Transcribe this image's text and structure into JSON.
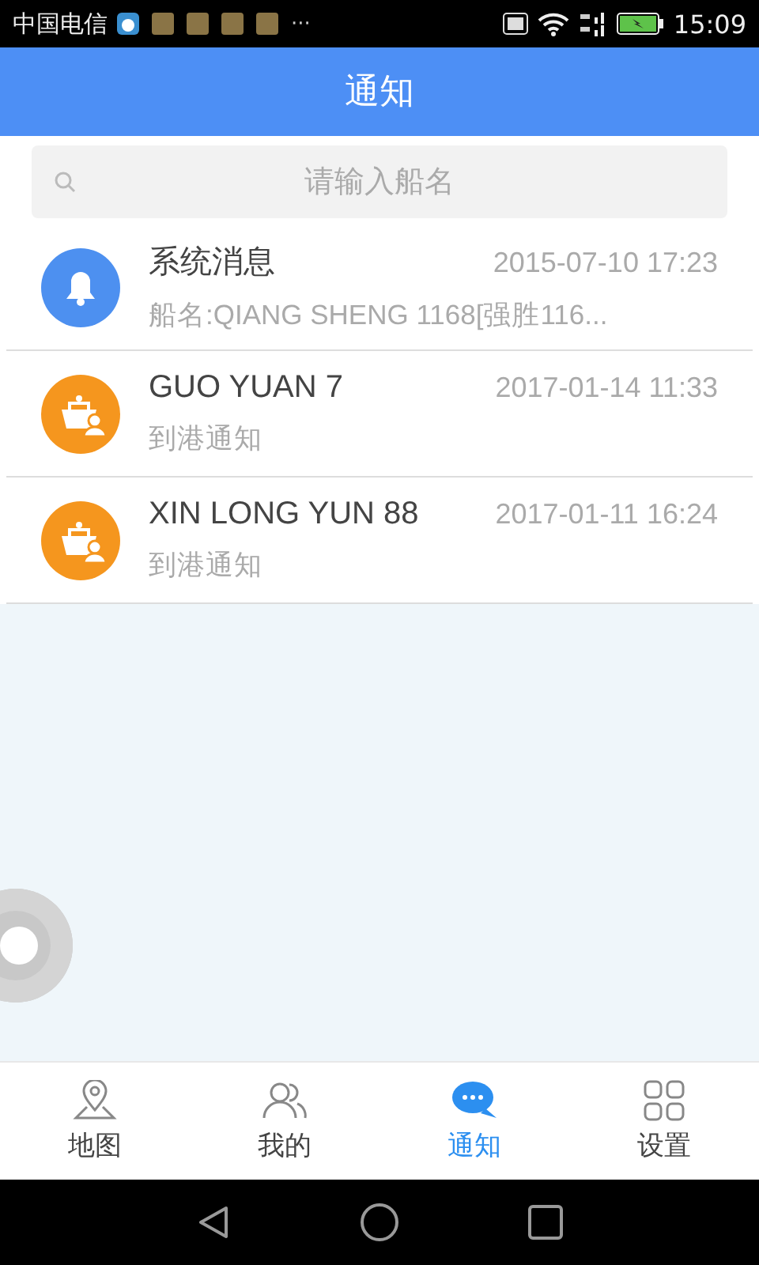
{
  "status_bar": {
    "carrier": "中国电信",
    "more": "···",
    "time": "15:09"
  },
  "header": {
    "title": "通知"
  },
  "search": {
    "placeholder": "请输入船名"
  },
  "messages": [
    {
      "kind": "system",
      "title": "系统消息",
      "time": "2015-07-10 17:23",
      "subtitle": "船名:QIANG SHENG 1168[强胜116..."
    },
    {
      "kind": "ship",
      "title": "GUO YUAN 7",
      "time": "2017-01-14 11:33",
      "subtitle": "到港通知"
    },
    {
      "kind": "ship",
      "title": "XIN LONG YUN 88",
      "time": "2017-01-11 16:24",
      "subtitle": "到港通知"
    }
  ],
  "tabs": [
    {
      "kind": "map",
      "label": "地图",
      "selected": false
    },
    {
      "kind": "people",
      "label": "我的",
      "selected": false
    },
    {
      "kind": "chat",
      "label": "通知",
      "selected": true
    },
    {
      "kind": "grid",
      "label": "设置",
      "selected": false
    }
  ]
}
